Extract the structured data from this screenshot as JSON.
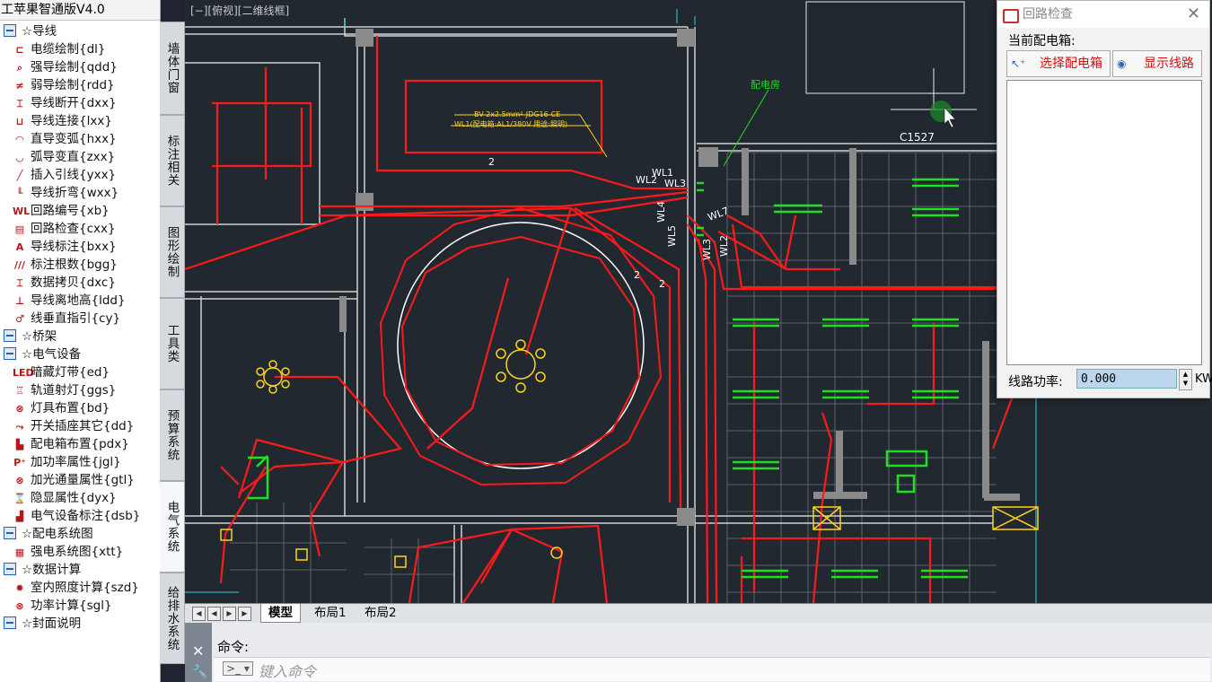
{
  "app": {
    "title": "工苹果智通版V4.0"
  },
  "tree": {
    "rows": [
      {
        "kind": "sec",
        "label": "☆导线",
        "icon": ""
      },
      {
        "kind": "item",
        "label": "电缆绘制{dl}",
        "icon": "cable-draw-icon"
      },
      {
        "kind": "item",
        "label": "强导绘制{qdd}",
        "icon": "strong-wire-icon"
      },
      {
        "kind": "item",
        "label": "弱导绘制{rdd}",
        "icon": "weak-wire-icon"
      },
      {
        "kind": "item",
        "label": "导线断开{dxx}",
        "icon": "wire-break-icon"
      },
      {
        "kind": "item",
        "label": "导线连接{lxx}",
        "icon": "wire-connect-icon"
      },
      {
        "kind": "item",
        "label": "直导变弧{hxx}",
        "icon": "line-to-arc-icon"
      },
      {
        "kind": "item",
        "label": "弧导变直{zxx}",
        "icon": "arc-to-line-icon"
      },
      {
        "kind": "item",
        "label": "插入引线{yxx}",
        "icon": "insert-lead-icon"
      },
      {
        "kind": "item",
        "label": "导线折弯{wxx}",
        "icon": "wire-bend-icon"
      },
      {
        "kind": "item",
        "label": "回路编号{xb}",
        "icon": "circuit-number-icon"
      },
      {
        "kind": "item",
        "label": "回路检查{cxx}",
        "icon": "circuit-check-icon"
      },
      {
        "kind": "item",
        "label": "导线标注{bxx}",
        "icon": "wire-label-icon"
      },
      {
        "kind": "item",
        "label": "标注根数{bgg}",
        "icon": "label-count-icon"
      },
      {
        "kind": "item",
        "label": "数据拷贝{dxc}",
        "icon": "data-copy-icon"
      },
      {
        "kind": "item",
        "label": "导线离地高{ldd}",
        "icon": "wire-height-icon"
      },
      {
        "kind": "item",
        "label": "线垂直指引{cy}",
        "icon": "vertical-leader-icon"
      },
      {
        "kind": "sec",
        "label": "☆桥架",
        "icon": ""
      },
      {
        "kind": "sec",
        "label": "☆电气设备",
        "icon": ""
      },
      {
        "kind": "item",
        "label": "暗藏灯带{ed}",
        "icon": "led-strip-icon"
      },
      {
        "kind": "item",
        "label": "轨道射灯{ggs}",
        "icon": "track-light-icon"
      },
      {
        "kind": "item",
        "label": "灯具布置{bd}",
        "icon": "lamp-layout-icon"
      },
      {
        "kind": "item",
        "label": "开关插座其它{dd}",
        "icon": "switch-socket-icon"
      },
      {
        "kind": "item",
        "label": "配电箱布置{pdx}",
        "icon": "distribution-box-icon"
      },
      {
        "kind": "item",
        "label": "加功率属性{jgl}",
        "icon": "power-attr-icon"
      },
      {
        "kind": "item",
        "label": "加光通量属性{gtl}",
        "icon": "flux-attr-icon"
      },
      {
        "kind": "item",
        "label": "隐显属性{dyx}",
        "icon": "toggle-attr-icon"
      },
      {
        "kind": "item",
        "label": "电气设备标注{dsb}",
        "icon": "equipment-label-icon"
      },
      {
        "kind": "sec",
        "label": "☆配电系统图",
        "icon": ""
      },
      {
        "kind": "item",
        "label": "强电系统图{xtt}",
        "icon": "system-diagram-icon"
      },
      {
        "kind": "sec",
        "label": "☆数据计算",
        "icon": ""
      },
      {
        "kind": "item",
        "label": "室内照度计算{szd}",
        "icon": "illuminance-calc-icon"
      },
      {
        "kind": "item",
        "label": "功率计算{sgl}",
        "icon": "power-calc-icon"
      },
      {
        "kind": "sec",
        "label": "☆封面说明",
        "icon": ""
      }
    ]
  },
  "vtabs": [
    "墙体门窗",
    "标注相关",
    "图形绘制",
    "工具类",
    "预算系统",
    "电气系统",
    "给排水系统"
  ],
  "canvas": {
    "view_label": "[−][俯视][二维线框]",
    "room_label": "配电房",
    "wire_spec_1": "BV-2x2.5mm²-JDG16-CE",
    "wire_spec_2": "WL1(配电箱:AL1/380V 用途:照明)",
    "door_tag": "C1527",
    "circuit_labels": [
      "WL1",
      "WL2",
      "WL3",
      "WL4",
      "WL5",
      "WL7",
      "WL3",
      "WL2"
    ],
    "count_marks": [
      "2",
      "2",
      "2"
    ]
  },
  "layout_tabs": [
    "模型",
    "布局1",
    "布局2"
  ],
  "command": {
    "label": "命令:",
    "placeholder": "键入命令"
  },
  "dialog": {
    "title": "回路检查",
    "current_box_label": "当前配电箱:",
    "select_button": "选择配电箱",
    "show_button": "显示线路",
    "power_label": "线路功率:",
    "power_value": "0.000",
    "power_unit": "KW"
  },
  "colors": {
    "wire": "#ff1a1a",
    "wall": "#d0d0d0",
    "grid": "#6a7078",
    "fixture": "#ffd21e",
    "green": "#1fe01f"
  }
}
